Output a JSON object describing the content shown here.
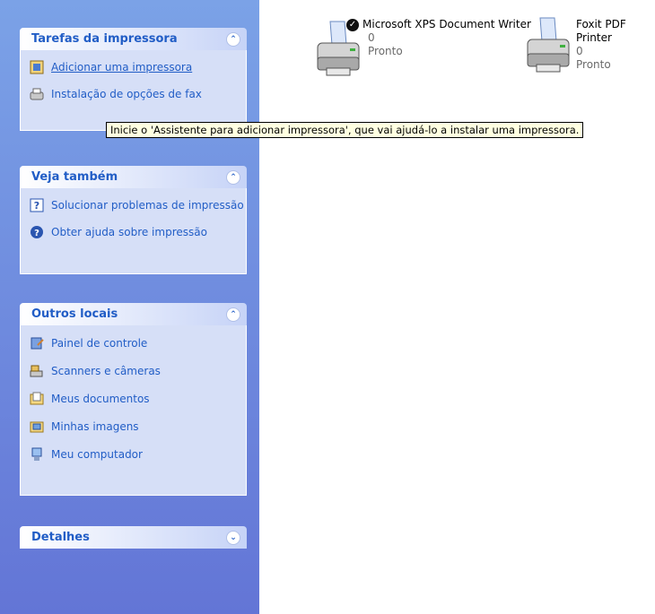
{
  "task_groups": [
    {
      "title": "Tarefas da impressora",
      "items": [
        {
          "label": "Adicionar uma impressora",
          "icon": "add-printer-icon"
        },
        {
          "label": "Instalação de opções de fax",
          "icon": "fax-icon"
        }
      ]
    },
    {
      "title": "Veja também",
      "items": [
        {
          "label": "Solucionar problemas de impressão",
          "icon": "help-question-icon"
        },
        {
          "label": "Obter ajuda sobre impressão",
          "icon": "help-circle-icon"
        }
      ]
    },
    {
      "title": "Outros locais",
      "items": [
        {
          "label": "Painel de controle",
          "icon": "control-panel-icon"
        },
        {
          "label": "Scanners e câmeras",
          "icon": "scanner-camera-icon"
        },
        {
          "label": "Meus documentos",
          "icon": "my-documents-icon"
        },
        {
          "label": "Minhas imagens",
          "icon": "my-pictures-icon"
        },
        {
          "label": "Meu computador",
          "icon": "my-computer-icon"
        }
      ]
    },
    {
      "title": "Detalhes",
      "items": []
    }
  ],
  "printers": [
    {
      "name": "Microsoft XPS Document Writer",
      "documents": "0",
      "status": "Pronto",
      "default": true
    },
    {
      "name": "Foxit PDF Printer",
      "documents": "0",
      "status": "Pronto",
      "default": false
    }
  ],
  "tooltip": "Inicie o 'Assistente para adicionar impressora', que vai ajudá-lo a instalar uma impressora.",
  "colors": {
    "pane_gradient_top": "#7ba2e7",
    "pane_gradient_bottom": "#6375d6",
    "link": "#215dc6",
    "group_body": "#d6dff7",
    "tooltip_bg": "#ffffe1"
  }
}
